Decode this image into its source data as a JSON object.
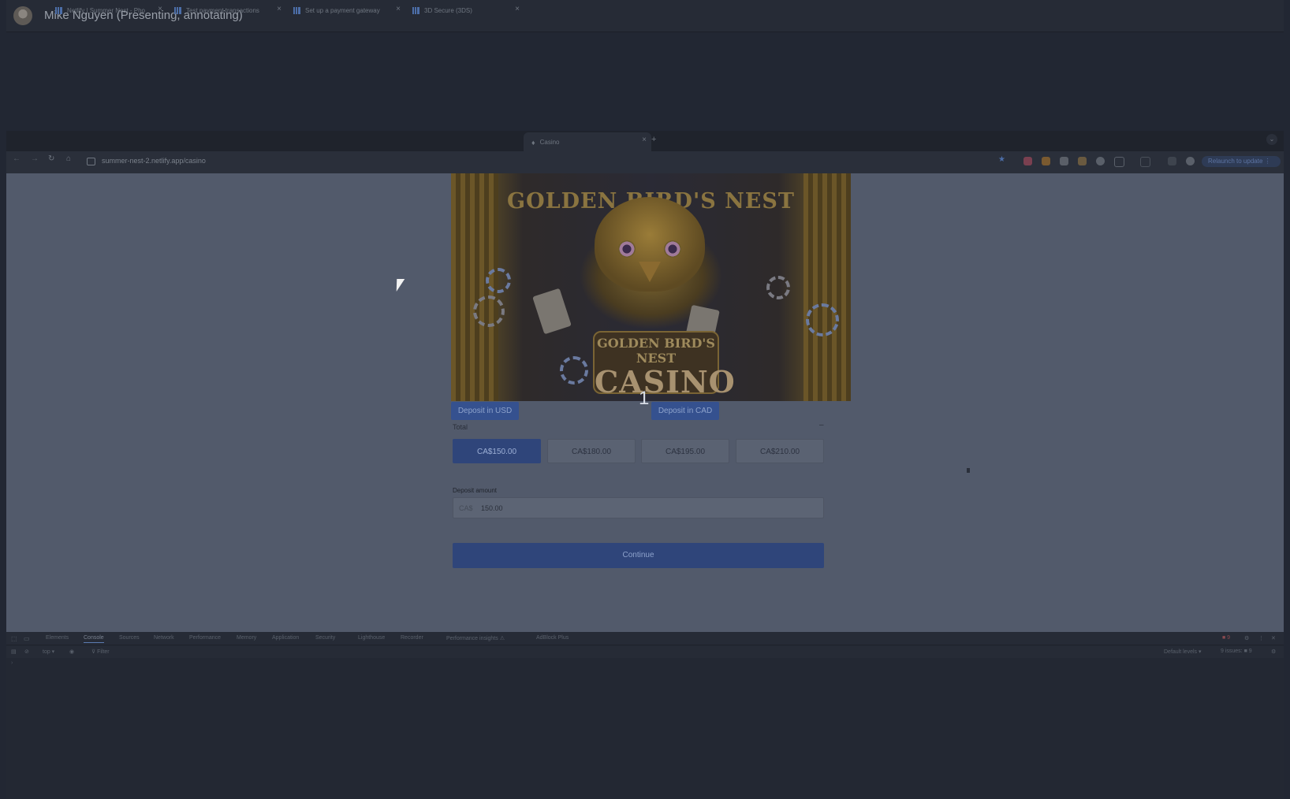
{
  "presenter": {
    "name": "Mike Nguyen (Presenting, annotating)"
  },
  "tabs": [
    {
      "label": "Netlify | Summer Nest - Pho",
      "close": "×"
    },
    {
      "label": "Test payment transactions",
      "close": "×"
    },
    {
      "label": "Set up a payment gateway",
      "close": "×"
    },
    {
      "label": "3D Secure (3DS)",
      "close": "×"
    },
    {
      "label": "Casino",
      "close": "×"
    }
  ],
  "tab_new": "+",
  "tab_menu": "⌄",
  "toolbar": {
    "back": "←",
    "forward": "→",
    "reload": "↻",
    "home": "⌂",
    "url": "summer-nest-2.netlify.app/casino",
    "bookmark": "★",
    "relaunch": "Relaunch to update ⋮"
  },
  "hero": {
    "arc_title": "GOLDEN BIRD'S NEST",
    "sign_top": "GOLDEN BIRD'S NEST",
    "sign_main": "CASINO"
  },
  "deposit": {
    "usd_label": "Deposit in USD",
    "cad_label": "Deposit in CAD",
    "annotation": "1",
    "total_label": "Total",
    "total_value": "–",
    "amounts": [
      "CA$150.00",
      "CA$180.00",
      "CA$195.00",
      "CA$210.00"
    ],
    "selected_index": 0,
    "amount_label": "Deposit amount",
    "amount_prefix": "CA$",
    "amount_value": "150.00",
    "continue_label": "Continue"
  },
  "devtools": {
    "tabs": [
      "Elements",
      "Console",
      "Sources",
      "Network",
      "Performance",
      "Memory",
      "Application",
      "Security",
      "Lighthouse",
      "Recorder",
      "Performance insights ⚠",
      "AdBlock Plus"
    ],
    "active_tab": "Console",
    "context": "top ▾",
    "filter": "Filter",
    "levels": "Default levels ▾",
    "issues": "9 issues: ■ 9",
    "prompt": "›"
  },
  "colors": {
    "accent": "#2f457a",
    "page_bg": "#525a6b",
    "app_bg": "#222733"
  }
}
